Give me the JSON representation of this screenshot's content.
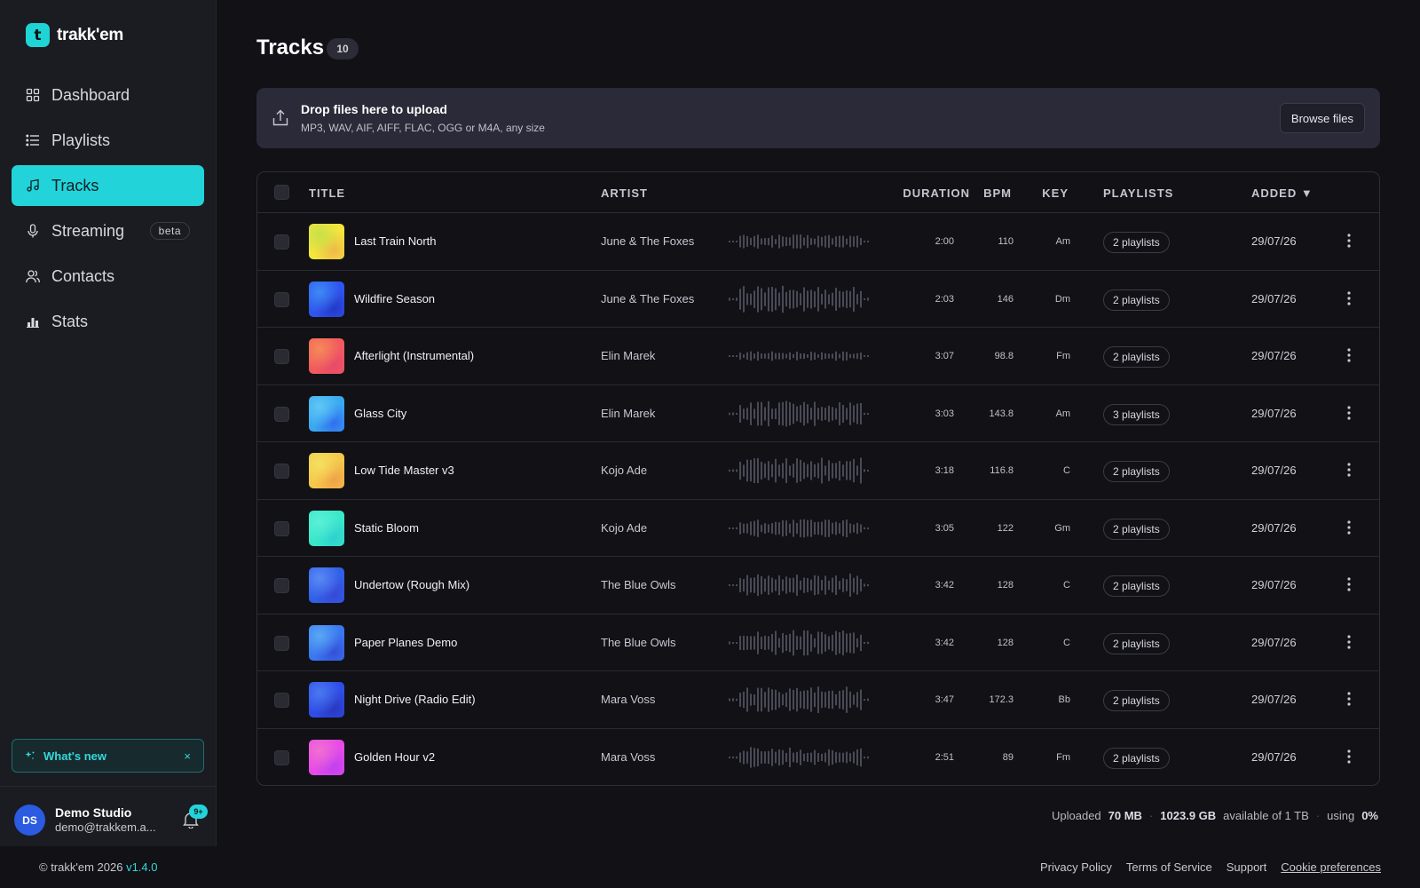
{
  "app": {
    "name": "trakk'em",
    "logo_glyph": "t",
    "accent": "#22d4d9"
  },
  "sidebar": {
    "items": [
      {
        "label": "Dashboard",
        "icon": "grid-icon",
        "active": false
      },
      {
        "label": "Playlists",
        "icon": "list-icon",
        "active": false
      },
      {
        "label": "Tracks",
        "icon": "music-note-icon",
        "active": true
      },
      {
        "label": "Streaming",
        "icon": "microphone-icon",
        "active": false,
        "badge": "beta"
      },
      {
        "label": "Contacts",
        "icon": "users-icon",
        "active": false
      },
      {
        "label": "Stats",
        "icon": "bar-chart-icon",
        "active": false
      }
    ],
    "whats_new": {
      "label": "What's new",
      "close": "×"
    },
    "user": {
      "initials": "DS",
      "name": "Demo Studio",
      "email": "demo@trakkem.a...",
      "notifications": "9+"
    }
  },
  "main": {
    "title": "Tracks",
    "count": "10",
    "upload": {
      "title": "Drop files here to upload",
      "subtitle": "MP3, WAV, AIF, AIFF, FLAC, OGG or M4A, any size",
      "button": "Browse files"
    },
    "table": {
      "headers": {
        "title": "TITLE",
        "artist": "ARTIST",
        "duration": "DURATION",
        "bpm": "BPM",
        "key": "KEY",
        "playlists": "PLAYLISTS",
        "added": "ADDED ▼"
      },
      "rows": [
        {
          "title": "Last Train North",
          "artist": "June & The Foxes",
          "duration": "2:00",
          "bpm": "110",
          "key": "Am",
          "playlists": "2 playlists",
          "added": "29/07/26",
          "art": [
            "#f5e63a",
            "#c8e04a",
            "#f0b84a"
          ]
        },
        {
          "title": "Wildfire Season",
          "artist": "June & The Foxes",
          "duration": "2:03",
          "bpm": "146",
          "key": "Dm",
          "playlists": "2 playlists",
          "added": "29/07/26",
          "art": [
            "#2f55f0",
            "#3d8af5",
            "#2438c8"
          ]
        },
        {
          "title": "Afterlight (Instrumental)",
          "artist": "Elin Marek",
          "duration": "3:07",
          "bpm": "98.8",
          "key": "Fm",
          "playlists": "2 playlists",
          "added": "29/07/26",
          "art": [
            "#f25a5e",
            "#f58a58",
            "#e84a6a"
          ]
        },
        {
          "title": "Glass City",
          "artist": "Elin Marek",
          "duration": "3:03",
          "bpm": "143.8",
          "key": "Am",
          "playlists": "3 playlists",
          "added": "29/07/26",
          "art": [
            "#3aa8f0",
            "#5fc8f5",
            "#2f6ef0"
          ]
        },
        {
          "title": "Low Tide Master v3",
          "artist": "Kojo Ade",
          "duration": "3:18",
          "bpm": "116.8",
          "key": "C",
          "playlists": "2 playlists",
          "added": "29/07/26",
          "art": [
            "#f5c84a",
            "#f5e060",
            "#f0a048"
          ]
        },
        {
          "title": "Static Bloom",
          "artist": "Kojo Ade",
          "duration": "3:05",
          "bpm": "122",
          "key": "Gm",
          "playlists": "2 playlists",
          "added": "29/07/26",
          "art": [
            "#3ae8c8",
            "#5af0d8",
            "#2ed0d0"
          ]
        },
        {
          "title": "Undertow (Rough Mix)",
          "artist": "The Blue Owls",
          "duration": "3:42",
          "bpm": "128",
          "key": "C",
          "playlists": "2 playlists",
          "added": "29/07/26",
          "art": [
            "#3060e8",
            "#5a8af5",
            "#3848d8"
          ]
        },
        {
          "title": "Paper Planes Demo",
          "artist": "The Blue Owls",
          "duration": "3:42",
          "bpm": "128",
          "key": "C",
          "playlists": "2 playlists",
          "added": "29/07/26",
          "art": [
            "#3a78f0",
            "#5aa8f5",
            "#3450d8"
          ]
        },
        {
          "title": "Night Drive (Radio Edit)",
          "artist": "Mara Voss",
          "duration": "3:47",
          "bpm": "172.3",
          "key": "Bb",
          "playlists": "2 playlists",
          "added": "29/07/26",
          "art": [
            "#2f4ee8",
            "#4a78f0",
            "#2838c0"
          ]
        },
        {
          "title": "Golden Hour v2",
          "artist": "Mara Voss",
          "duration": "2:51",
          "bpm": "89",
          "key": "Fm",
          "playlists": "2 playlists",
          "added": "29/07/26",
          "art": [
            "#e84ae8",
            "#f070d0",
            "#c040f0"
          ]
        }
      ]
    },
    "storage": {
      "uploaded_label": "Uploaded",
      "uploaded_value": "70 MB",
      "available_value": "1023.9 GB",
      "available_label": "available of 1 TB",
      "using_label": "using",
      "using_value": "0%"
    }
  },
  "footer": {
    "copyright": "© trakk'em 2026",
    "version": "v1.4.0",
    "links": [
      "Privacy Policy",
      "Terms of Service",
      "Support",
      "Cookie preferences"
    ]
  }
}
